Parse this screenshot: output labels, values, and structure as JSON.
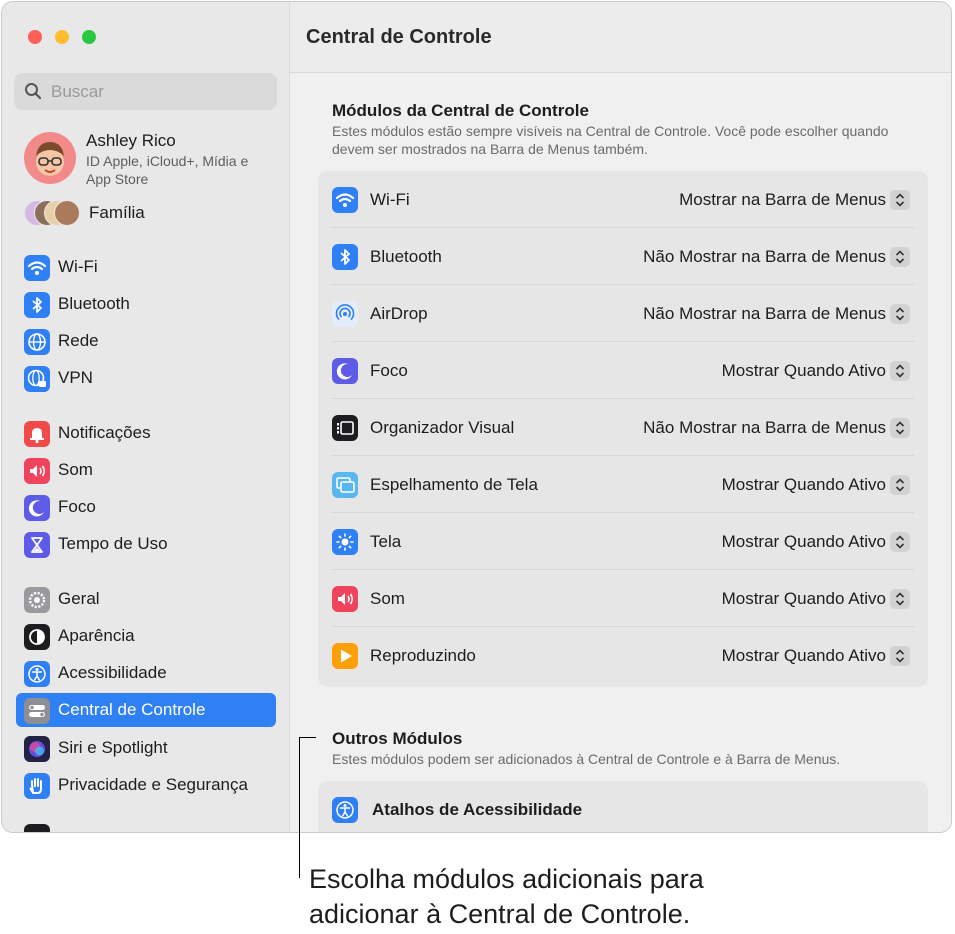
{
  "window": {
    "title": "Central de Controle",
    "traffic_lights": {
      "close": "#ff5f57",
      "minimize": "#febc2e",
      "zoom": "#28c840"
    }
  },
  "sidebar": {
    "search_placeholder": "Buscar",
    "profile": {
      "name": "Ashley Rico",
      "subtitle": "ID Apple, iCloud+, Mídia e App Store"
    },
    "family_label": "Família",
    "items": [
      {
        "label": "Wi-Fi",
        "icon": "wifi-icon",
        "color": "#2f7ff5"
      },
      {
        "label": "Bluetooth",
        "icon": "bluetooth-icon",
        "color": "#2f7ff5"
      },
      {
        "label": "Rede",
        "icon": "globe-icon",
        "color": "#2f7ff5"
      },
      {
        "label": "VPN",
        "icon": "vpn-globe-icon",
        "color": "#2f7ff5"
      },
      {
        "label": "Notificações",
        "icon": "bell-icon",
        "color": "#f04a4a"
      },
      {
        "label": "Som",
        "icon": "speaker-icon",
        "color": "#f0435c"
      },
      {
        "label": "Foco",
        "icon": "moon-icon",
        "color": "#5e5ce6"
      },
      {
        "label": "Tempo de Uso",
        "icon": "hourglass-icon",
        "color": "#5e5ce6"
      },
      {
        "label": "Geral",
        "icon": "gear-icon",
        "color": "#9a9a9e"
      },
      {
        "label": "Aparência",
        "icon": "appearance-icon",
        "color": "#1d1d1f"
      },
      {
        "label": "Acessibilidade",
        "icon": "accessibility-icon",
        "color": "#2f7ff5"
      },
      {
        "label": "Central de Controle",
        "icon": "control-center-icon",
        "color": "#8e8e93"
      },
      {
        "label": "Siri e Spotlight",
        "icon": "siri-icon",
        "color": "#222244"
      },
      {
        "label": "Privacidade e Segurança",
        "icon": "hand-icon",
        "color": "#2f7ff5"
      }
    ]
  },
  "modules": {
    "title": "Módulos da Central de Controle",
    "description": "Estes módulos estão sempre visíveis na Central de Controle. Você pode escolher quando devem ser mostrados na Barra de Menus também.",
    "rows": [
      {
        "label": "Wi-Fi",
        "value": "Mostrar na Barra de Menus",
        "icon": "wifi-icon",
        "color": "#2f7ff5"
      },
      {
        "label": "Bluetooth",
        "value": "Não Mostrar na Barra de Menus",
        "icon": "bluetooth-icon",
        "color": "#2f7ff5"
      },
      {
        "label": "AirDrop",
        "value": "Não Mostrar na Barra de Menus",
        "icon": "airdrop-icon",
        "color": "#e5edfb"
      },
      {
        "label": "Foco",
        "value": "Mostrar Quando Ativo",
        "icon": "moon-icon",
        "color": "#5e5ce6"
      },
      {
        "label": "Organizador Visual",
        "value": "Não Mostrar na Barra de Menus",
        "icon": "stage-manager-icon",
        "color": "#1d1d1f"
      },
      {
        "label": "Espelhamento de Tela",
        "value": "Mostrar Quando Ativo",
        "icon": "screen-mirroring-icon",
        "color": "#5ab6f0"
      },
      {
        "label": "Tela",
        "value": "Mostrar Quando Ativo",
        "icon": "sun-icon",
        "color": "#2f7ff5"
      },
      {
        "label": "Som",
        "value": "Mostrar Quando Ativo",
        "icon": "speaker-icon",
        "color": "#f0435c"
      },
      {
        "label": "Reproduzindo",
        "value": "Mostrar Quando Ativo",
        "icon": "play-icon",
        "color": "#ff9f0a"
      }
    ]
  },
  "other_modules": {
    "title": "Outros Módulos",
    "description": "Estes módulos podem ser adicionados à Central de Controle e à Barra de Menus.",
    "rows": [
      {
        "label": "Atalhos de Acessibilidade",
        "icon": "accessibility-icon",
        "color": "#2f7ff5"
      }
    ]
  },
  "callout": {
    "text": "Escolha módulos adicionais para adicionar à Central de Controle."
  }
}
